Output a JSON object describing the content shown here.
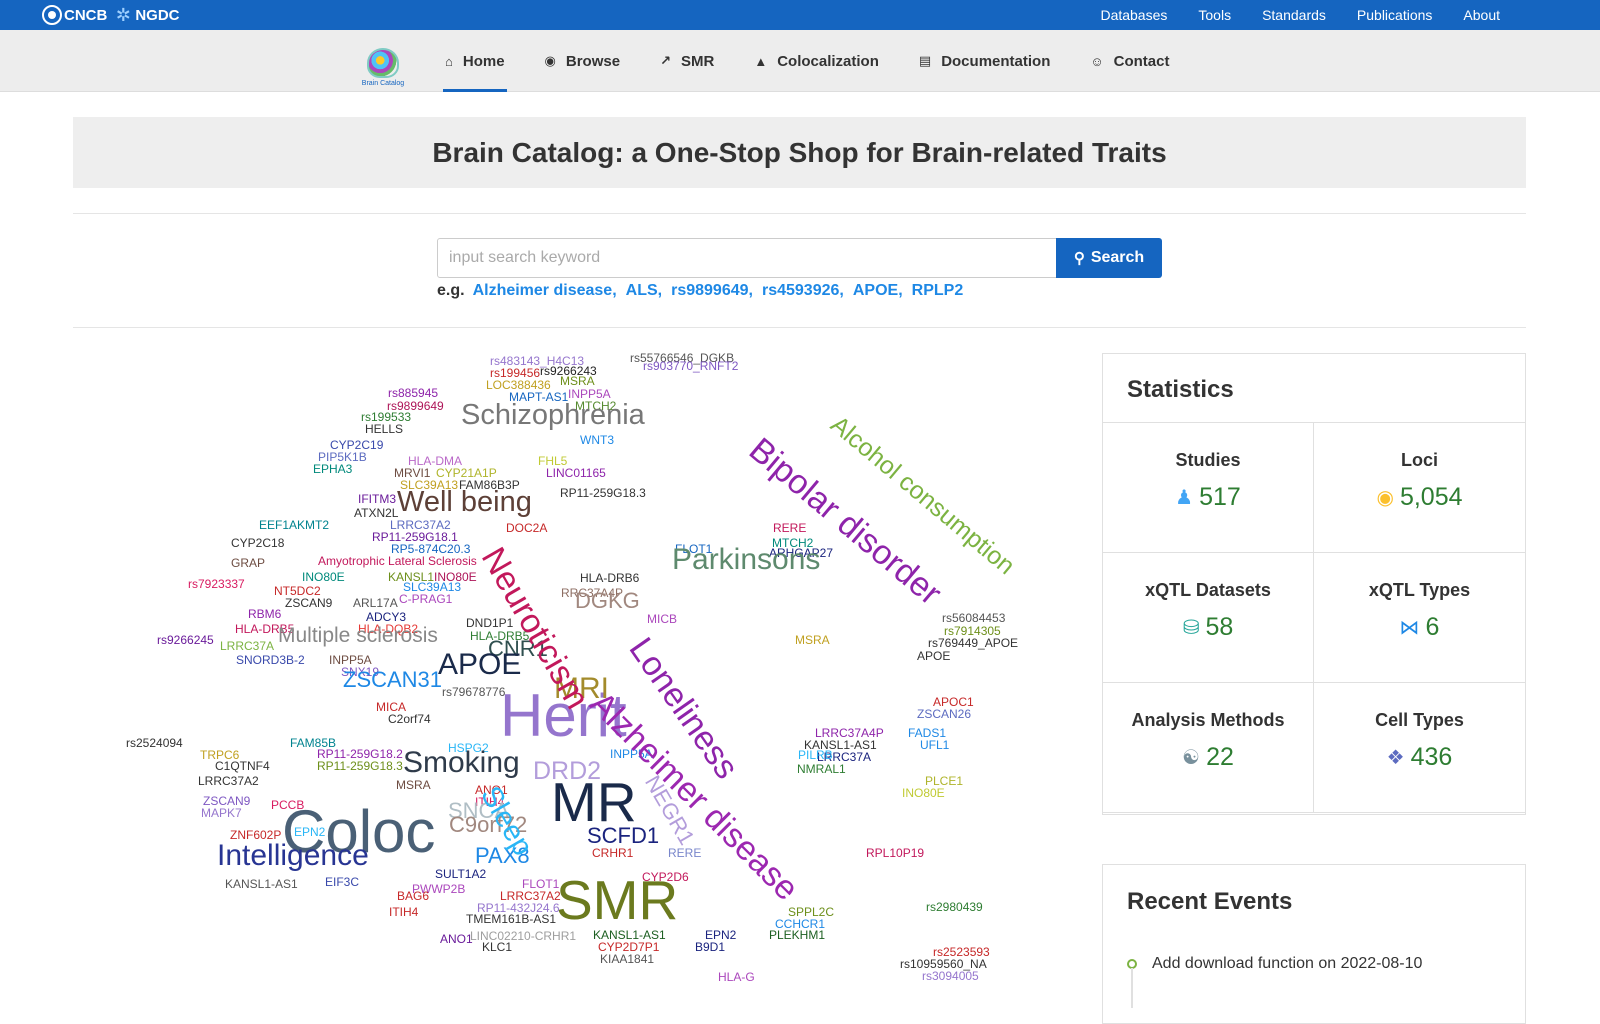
{
  "topbar": {
    "logo_cncb": "CNCB",
    "logo_ngdc": "NGDC",
    "links": [
      "Databases",
      "Tools",
      "Standards",
      "Publications",
      "About"
    ]
  },
  "navbar": {
    "brand_text": "Brain Catalog",
    "items": [
      {
        "label": "Home",
        "icon": "home-icon"
      },
      {
        "label": "Browse",
        "icon": "eye-icon"
      },
      {
        "label": "SMR",
        "icon": "line-chart-icon"
      },
      {
        "label": "Colocalization",
        "icon": "area-chart-icon"
      },
      {
        "label": "Documentation",
        "icon": "document-icon"
      },
      {
        "label": "Contact",
        "icon": "contact-icon"
      }
    ],
    "active": "Home"
  },
  "hero": {
    "title": "Brain Catalog: a One-Stop Shop for Brain-related Traits"
  },
  "search": {
    "placeholder": "input search keyword",
    "value": "",
    "button_label": "Search",
    "examples_prefix": "e.g.",
    "examples": [
      "Alzheimer disease",
      "ALS",
      "rs9899649",
      "rs4593926",
      "APOE",
      "RPLP2"
    ]
  },
  "wordcloud": {
    "words": [
      {
        "text": "rs55766546_DGKB",
        "color": "#555"
      },
      {
        "text": "rs483143_H4C13",
        "color": "#9575cd"
      },
      {
        "text": "rs9266243",
        "color": "#222"
      },
      {
        "text": "rs903770_RNFT2",
        "color": "#7e57c2"
      },
      {
        "text": "rs199456",
        "color": "#c62828"
      },
      {
        "text": "LOC388436",
        "color": "#c0a020"
      },
      {
        "text": "MSRA",
        "color": "#6d8f1a"
      },
      {
        "text": "rs885945",
        "color": "#8e24aa"
      },
      {
        "text": "INPP5A",
        "color": "#ab47bc"
      },
      {
        "text": "MAPT-AS1",
        "color": "#1565c0"
      },
      {
        "text": "MTCH2",
        "color": "#558b2f"
      },
      {
        "text": "rs9899649",
        "color": "#ad1457"
      },
      {
        "text": "rs199533",
        "color": "#2e7d32"
      },
      {
        "text": "HELLS",
        "color": "#333"
      },
      {
        "text": "Schizophrenia",
        "color": "#777"
      },
      {
        "text": "WNT3",
        "color": "#1e88e5"
      },
      {
        "text": "CYP2C19",
        "color": "#3949ab"
      },
      {
        "text": "PIP5K1B",
        "color": "#5c6bc0"
      },
      {
        "text": "EPHA3",
        "color": "#00897b"
      },
      {
        "text": "HLA-DMA",
        "color": "#ba68c8"
      },
      {
        "text": "FHL5",
        "color": "#c0ca33"
      },
      {
        "text": "MRVI1",
        "color": "#6d4c41"
      },
      {
        "text": "CYP21A1P",
        "color": "#afb42b"
      },
      {
        "text": "LINC01165",
        "color": "#8e24aa"
      },
      {
        "text": "SLC39A13",
        "color": "#c0a020"
      },
      {
        "text": "FAM86B3P",
        "color": "#333"
      },
      {
        "text": "RP11-259G18.3",
        "color": "#333"
      },
      {
        "text": "IFITM3",
        "color": "#6a1b9a"
      },
      {
        "text": "Well being",
        "color": "#5d4037"
      },
      {
        "text": "ATXN2L",
        "color": "#333"
      },
      {
        "text": "EEF1AKMT2",
        "color": "#00838f"
      },
      {
        "text": "LRRC37A2",
        "color": "#5c6bc0"
      },
      {
        "text": "DOC2A",
        "color": "#c62828"
      },
      {
        "text": "RP11-259G18.1",
        "color": "#6a1b9a"
      },
      {
        "text": "CYP2C18",
        "color": "#333"
      },
      {
        "text": "RP5-874C20.3",
        "color": "#1565c0"
      },
      {
        "text": "FLOT1",
        "color": "#1565c0"
      },
      {
        "text": "ARHGAP27",
        "color": "#1a237e"
      },
      {
        "text": "MTCH2",
        "color": "#00897b"
      },
      {
        "text": "RERE",
        "color": "#c2185b"
      },
      {
        "text": "GRAP",
        "color": "#6d4c41"
      },
      {
        "text": "Amyotrophic Lateral Sclerosis",
        "color": "#c2185b"
      },
      {
        "text": "Parkinsons",
        "color": "#5e8a6e"
      },
      {
        "text": "INO80E",
        "color": "#00897b"
      },
      {
        "text": "KANSL1",
        "color": "#6d8f1a"
      },
      {
        "text": "INO80E",
        "color": "#ad1457"
      },
      {
        "text": "HLA-DRB6",
        "color": "#333"
      },
      {
        "text": "rs7923337",
        "color": "#d81b60"
      },
      {
        "text": "SLC39A13",
        "color": "#1e88e5"
      },
      {
        "text": "NT5DC2",
        "color": "#c62828"
      },
      {
        "text": "RRC37A4P",
        "color": "#8d6e63"
      },
      {
        "text": "DGKG",
        "color": "#a1887f"
      },
      {
        "text": "ZSCAN9",
        "color": "#333"
      },
      {
        "text": "C-PRAG1",
        "color": "#ab47bc"
      },
      {
        "text": "ARL17A",
        "color": "#555"
      },
      {
        "text": "RBM6",
        "color": "#8e24aa"
      },
      {
        "text": "ADCY3",
        "color": "#1a237e"
      },
      {
        "text": "HLA-DRB5",
        "color": "#c2185b"
      },
      {
        "text": "HLA-DQB2",
        "color": "#e53935"
      },
      {
        "text": "DND1P1",
        "color": "#333"
      },
      {
        "text": "MICB",
        "color": "#ab47bc"
      },
      {
        "text": "rs9266245",
        "color": "#6a1b9a"
      },
      {
        "text": "Multiple sclerosis",
        "color": "#888"
      },
      {
        "text": "HLA-DRB5",
        "color": "#2e7d32"
      },
      {
        "text": "CNR1",
        "color": "#2f4f4f"
      },
      {
        "text": "MSRA",
        "color": "#c0a020"
      },
      {
        "text": "rs769449_APOE",
        "color": "#333"
      },
      {
        "text": "LRRC37A",
        "color": "#7cb342"
      },
      {
        "text": "SNORD3B-2",
        "color": "#3949ab"
      },
      {
        "text": "INPP5A",
        "color": "#6d4c41"
      },
      {
        "text": "APOE",
        "color": "#1a2a4a"
      },
      {
        "text": "APOE",
        "color": "#333"
      },
      {
        "text": "SNX19",
        "color": "#7e57c2"
      },
      {
        "text": "ZSCAN31",
        "color": "#1e88e5"
      },
      {
        "text": "rs79678776",
        "color": "#555"
      },
      {
        "text": "APOC1",
        "color": "#c62828"
      },
      {
        "text": "ZSCAN26",
        "color": "#5c6bc0"
      },
      {
        "text": "MICA",
        "color": "#c62828"
      },
      {
        "text": "C2orf74",
        "color": "#333"
      },
      {
        "text": "Herit",
        "color": "#9575cd"
      },
      {
        "text": "MRI",
        "color": "#a38b2b"
      },
      {
        "text": "LRRC37A4P",
        "color": "#8e24aa"
      },
      {
        "text": "FADS1",
        "color": "#1e88e5"
      },
      {
        "text": "KANSL1-AS1",
        "color": "#333"
      },
      {
        "text": "UFL1",
        "color": "#1e88e5"
      },
      {
        "text": "rs2524094",
        "color": "#333"
      },
      {
        "text": "FAM85B",
        "color": "#00838f"
      },
      {
        "text": "HSPG2",
        "color": "#29b6f6"
      },
      {
        "text": "RP11-259G18.2",
        "color": "#8e24aa"
      },
      {
        "text": "INPP5A",
        "color": "#1e88e5"
      },
      {
        "text": "LRRC37A",
        "color": "#1a237e"
      },
      {
        "text": "PILRB",
        "color": "#29b6f6"
      },
      {
        "text": "NMRAL1",
        "color": "#2e7d32"
      },
      {
        "text": "TRPC6",
        "color": "#c0a020"
      },
      {
        "text": "RP11-259G18.3",
        "color": "#6d8f1a"
      },
      {
        "text": "Smoking",
        "color": "#2f3b4a"
      },
      {
        "text": "C1QTNF4",
        "color": "#333"
      },
      {
        "text": "LRRC37A2",
        "color": "#333"
      },
      {
        "text": "MSRA",
        "color": "#6d4c41"
      },
      {
        "text": "ANO1",
        "color": "#c62828"
      },
      {
        "text": "ITIH4",
        "color": "#d81b60"
      },
      {
        "text": "MR",
        "color": "#1a2a4a"
      },
      {
        "text": "DRD2",
        "color": "#b39ddb"
      },
      {
        "text": "PLCE1",
        "color": "#afb42b"
      },
      {
        "text": "INO80E",
        "color": "#c0ca33"
      },
      {
        "text": "ZSCAN9",
        "color": "#7e57c2"
      },
      {
        "text": "MAPK7",
        "color": "#9575cd"
      },
      {
        "text": "PCCB",
        "color": "#d81b60"
      },
      {
        "text": "SNCA",
        "color": "#b0bec5"
      },
      {
        "text": "Coloc",
        "color": "#4a6076"
      },
      {
        "text": "EPN2",
        "color": "#29b6f6"
      },
      {
        "text": "ZNF602P",
        "color": "#c62828"
      },
      {
        "text": "C9orf72",
        "color": "#a1887f"
      },
      {
        "text": "SCFD1",
        "color": "#1a237e"
      },
      {
        "text": "CRHR1",
        "color": "#c62828"
      },
      {
        "text": "RERE",
        "color": "#7986cb"
      },
      {
        "text": "RPL10P19",
        "color": "#c2185b"
      },
      {
        "text": "Intelligence",
        "color": "#283593"
      },
      {
        "text": "PAX8",
        "color": "#1e88e5"
      },
      {
        "text": "EIF3C",
        "color": "#3949ab"
      },
      {
        "text": "KANSL1-AS1",
        "color": "#555"
      },
      {
        "text": "SULT1A2",
        "color": "#1a237e"
      },
      {
        "text": "PWWP2B",
        "color": "#ab47bc"
      },
      {
        "text": "FLOT1",
        "color": "#ab47bc"
      },
      {
        "text": "CYP2D6",
        "color": "#c2185b"
      },
      {
        "text": "BAG6",
        "color": "#c62828"
      },
      {
        "text": "LRRC37A2",
        "color": "#c62828"
      },
      {
        "text": "SMR",
        "color": "#6b7a1e"
      },
      {
        "text": "RP11-432J24.6",
        "color": "#9575cd"
      },
      {
        "text": "ITIH4",
        "color": "#c62828"
      },
      {
        "text": "TMEM161B-AS1",
        "color": "#333"
      },
      {
        "text": "SPPL2C",
        "color": "#6d8f1a"
      },
      {
        "text": "CCHCR1",
        "color": "#1e88e5"
      },
      {
        "text": "rs2980439",
        "color": "#2e7d32"
      },
      {
        "text": "KANSL1-AS1",
        "color": "#1b5e20"
      },
      {
        "text": "EPN2",
        "color": "#1a237e"
      },
      {
        "text": "PLEKHM1",
        "color": "#1b5e20"
      },
      {
        "text": "ANO1",
        "color": "#6a1b9a"
      },
      {
        "text": "LINC02210-CRHR1",
        "color": "#9e9e9e"
      },
      {
        "text": "CYP2D7P1",
        "color": "#c62828"
      },
      {
        "text": "KLC1",
        "color": "#333"
      },
      {
        "text": "B9D1",
        "color": "#1a237e"
      },
      {
        "text": "KIAA1841",
        "color": "#555"
      },
      {
        "text": "rs2523593",
        "color": "#c62828"
      },
      {
        "text": "rs10959560_NA",
        "color": "#333"
      },
      {
        "text": "rs3094005",
        "color": "#9575cd"
      },
      {
        "text": "HLA-G",
        "color": "#ab47bc"
      },
      {
        "text": "rs56084453",
        "color": "#555"
      },
      {
        "text": "rs7914305",
        "color": "#6d8f1a"
      },
      {
        "text": "Neuroticism",
        "color": "#c2185b"
      },
      {
        "text": "Loneliness",
        "color": "#8e24aa"
      },
      {
        "text": "Alzheimer disease",
        "color": "#9c27b0"
      },
      {
        "text": "Bipolar disorder",
        "color": "#8e24aa"
      },
      {
        "text": "Alcohol consumption",
        "color": "#7cb342"
      },
      {
        "text": "Sleep",
        "color": "#29b6f6"
      },
      {
        "text": "NEGR1",
        "color": "#b39ddb"
      }
    ]
  },
  "stats": {
    "title": "Statistics",
    "cells": [
      {
        "label": "Studies",
        "value": "517",
        "icon": "people-icon"
      },
      {
        "label": "Loci",
        "value": "5,054",
        "icon": "map-pin-icon"
      },
      {
        "label": "xQTL Datasets",
        "value": "58",
        "icon": "database-icon"
      },
      {
        "label": "xQTL Types",
        "value": "6",
        "icon": "dna-icon"
      },
      {
        "label": "Analysis Methods",
        "value": "22",
        "icon": "brain-icon"
      },
      {
        "label": "Cell Types",
        "value": "436",
        "icon": "cells-icon"
      }
    ]
  },
  "events": {
    "title": "Recent Events",
    "items": [
      "Add download function on 2022-08-10"
    ]
  }
}
